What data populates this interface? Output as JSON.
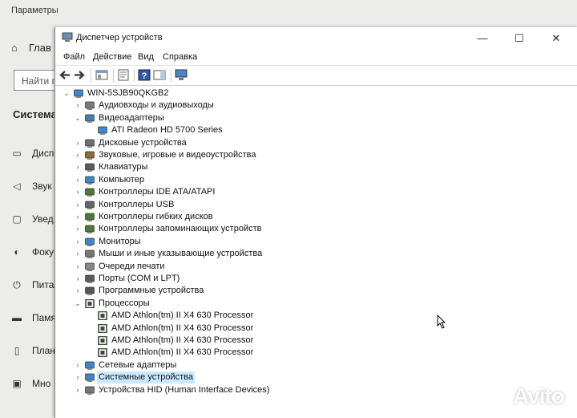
{
  "settings": {
    "title": "Параметры",
    "home_label": "Глав",
    "search_placeholder": "Найти п",
    "section": "Система",
    "items": [
      {
        "label": "Дисп",
        "icon": "display-icon"
      },
      {
        "label": "Звук",
        "icon": "sound-icon"
      },
      {
        "label": "Увед",
        "icon": "notifications-icon"
      },
      {
        "label": "Фоку",
        "icon": "focus-icon"
      },
      {
        "label": "Пита",
        "icon": "power-icon"
      },
      {
        "label": "Памя",
        "icon": "storage-icon"
      },
      {
        "label": "План",
        "icon": "tablet-icon"
      },
      {
        "label": "Мно",
        "icon": "multitasking-icon"
      }
    ]
  },
  "device_manager": {
    "title": "Диспетчер устройств",
    "menu": [
      "Файл",
      "Действие",
      "Вид",
      "Справка"
    ],
    "tree": {
      "root": "WIN-5SJB90QKGB2",
      "nodes": [
        {
          "label": "Аудиовходы и аудиовыходы",
          "expanded": false,
          "icon": "audio-io-icon"
        },
        {
          "label": "Видеоадаптеры",
          "expanded": true,
          "icon": "display-adapter-icon",
          "children": [
            "ATI Radeon HD 5700 Series"
          ]
        },
        {
          "label": "Дисковые устройства",
          "expanded": false,
          "icon": "disk-icon"
        },
        {
          "label": "Звуковые, игровые и видеоустройства",
          "expanded": false,
          "icon": "sound-video-icon"
        },
        {
          "label": "Клавиатуры",
          "expanded": false,
          "icon": "keyboard-icon"
        },
        {
          "label": "Компьютер",
          "expanded": false,
          "icon": "computer-icon"
        },
        {
          "label": "Контроллеры IDE ATA/ATAPI",
          "expanded": false,
          "icon": "ide-controller-icon"
        },
        {
          "label": "Контроллеры USB",
          "expanded": false,
          "icon": "usb-icon"
        },
        {
          "label": "Контроллеры гибких дисков",
          "expanded": false,
          "icon": "floppy-controller-icon"
        },
        {
          "label": "Контроллеры запоминающих устройств",
          "expanded": false,
          "icon": "storage-controller-icon"
        },
        {
          "label": "Мониторы",
          "expanded": false,
          "icon": "monitor-icon"
        },
        {
          "label": "Мыши и иные указывающие устройства",
          "expanded": false,
          "icon": "mouse-icon"
        },
        {
          "label": "Очереди печати",
          "expanded": false,
          "icon": "printer-icon"
        },
        {
          "label": "Порты (COM и LPT)",
          "expanded": false,
          "icon": "port-icon"
        },
        {
          "label": "Программные устройства",
          "expanded": false,
          "icon": "software-device-icon"
        },
        {
          "label": "Процессоры",
          "expanded": true,
          "icon": "processor-icon",
          "children": [
            "AMD Athlon(tm) II X4 630 Processor",
            "AMD Athlon(tm) II X4 630 Processor",
            "AMD Athlon(tm) II X4 630 Processor",
            "AMD Athlon(tm) II X4 630 Processor"
          ]
        },
        {
          "label": "Сетевые адаптеры",
          "expanded": false,
          "icon": "network-adapter-icon"
        },
        {
          "label": "Системные устройства",
          "expanded": false,
          "selected": true,
          "icon": "system-device-icon"
        },
        {
          "label": "Устройства HID (Human Interface Devices)",
          "expanded": false,
          "icon": "hid-icon"
        }
      ]
    }
  },
  "watermark": "Avito"
}
